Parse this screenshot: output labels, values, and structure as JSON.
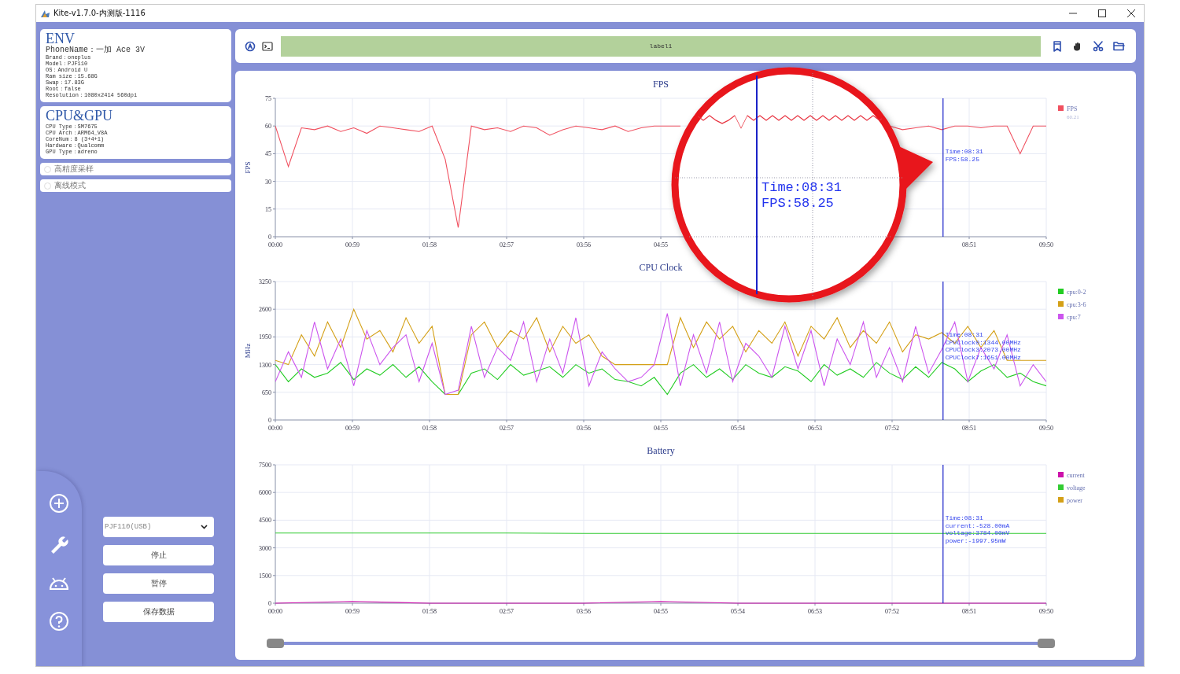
{
  "window": {
    "title": "Kite-v1.7.0-内测版-1116"
  },
  "env_card": {
    "title": "ENV",
    "lines": [
      "PhoneName：一加 Ace 3V",
      "Brand：oneplus",
      "Model：PJF110",
      "OS：Android U",
      "Ram size：15.68G",
      "Swap：17.83G",
      "Root：false",
      "Resolution：1080x2414 560dpi"
    ]
  },
  "cpu_card": {
    "title": "CPU&GPU",
    "lines": [
      "CPU Type：SM7675",
      "CPU Arch：ARM64_V8A",
      "CoreNum：8 (3+4+1)",
      "Hardware：Qualcomm",
      "GPU Type：adreno"
    ]
  },
  "options": [
    {
      "label": "高精度采样",
      "checked": false
    },
    {
      "label": "离线模式",
      "checked": false
    }
  ],
  "device_select": {
    "value": "PJF110(USB)"
  },
  "buttons": [
    "停止",
    "暂停",
    "保存数据"
  ],
  "toolbar": {
    "label": "label1"
  },
  "charts": [
    {
      "legend_note": "60.21",
      "tooltip": [
        "Time:08:31",
        "FPS:58.25"
      ],
      "chart_data": {
        "type": "line",
        "title": "FPS",
        "ylabel": "FPS",
        "grid": true,
        "legend": true,
        "xlim": [
          0,
          590
        ],
        "ylim": [
          0,
          75
        ],
        "yticks": [
          0,
          15,
          30,
          45,
          60,
          75
        ],
        "xticks": [
          {
            "value": 0,
            "label": "00:00"
          },
          {
            "value": 59,
            "label": "00:59"
          },
          {
            "value": 118,
            "label": "01:58"
          },
          {
            "value": 177,
            "label": "02:57"
          },
          {
            "value": 236,
            "label": "03:56"
          },
          {
            "value": 295,
            "label": "04:55"
          },
          {
            "value": 531,
            "label": "08:51"
          },
          {
            "value": 590,
            "label": "09:50"
          }
        ],
        "x": [
          0,
          10,
          20,
          30,
          40,
          50,
          60,
          70,
          80,
          90,
          100,
          110,
          120,
          130,
          140,
          150,
          160,
          170,
          180,
          190,
          200,
          210,
          220,
          230,
          240,
          250,
          260,
          270,
          280,
          290,
          300,
          310,
          470,
          480,
          490,
          500,
          510,
          520,
          530,
          540,
          550,
          560,
          570,
          580,
          590
        ],
        "series": [
          {
            "name": "FPS",
            "color": "#f0505f",
            "values": [
              60,
              38,
              59,
              58,
              60,
              57,
              59,
              56,
              60,
              59,
              58,
              57,
              60,
              42,
              5,
              60,
              58,
              59,
              57,
              60,
              59,
              55,
              58,
              60,
              59,
              58,
              60,
              57,
              59,
              60,
              60,
              60,
              60,
              58,
              59,
              60,
              58,
              60,
              60,
              59,
              60,
              60,
              45,
              60,
              60
            ]
          }
        ],
        "ref_lines": [
          {
            "axis": "x",
            "value": 511,
            "color": "#1a22c8"
          }
        ]
      }
    },
    {
      "tooltip": [
        "Time:08:31",
        "CPUClock0:1344.00MHz",
        "CPUClock3:2073.00MHz",
        "CPUClock7:1651.00MHz"
      ],
      "chart_data": {
        "type": "line",
        "title": "CPU Clock",
        "ylabel": "MHz",
        "grid": true,
        "legend": true,
        "xlim": [
          0,
          590
        ],
        "ylim": [
          0,
          3250
        ],
        "yticks": [
          0,
          650,
          1300,
          1950,
          2600,
          3250
        ],
        "xticks": [
          {
            "value": 0,
            "label": "00:00"
          },
          {
            "value": 59,
            "label": "00:59"
          },
          {
            "value": 118,
            "label": "01:58"
          },
          {
            "value": 177,
            "label": "02:57"
          },
          {
            "value": 236,
            "label": "03:56"
          },
          {
            "value": 295,
            "label": "04:55"
          },
          {
            "value": 354,
            "label": "05:54"
          },
          {
            "value": 413,
            "label": "06:53"
          },
          {
            "value": 472,
            "label": "07:52"
          },
          {
            "value": 531,
            "label": "08:51"
          },
          {
            "value": 590,
            "label": "09:50"
          }
        ],
        "x": [
          0,
          10,
          20,
          30,
          40,
          50,
          60,
          70,
          80,
          90,
          100,
          110,
          120,
          130,
          140,
          150,
          160,
          170,
          180,
          190,
          200,
          210,
          220,
          230,
          240,
          250,
          260,
          270,
          280,
          290,
          300,
          310,
          320,
          330,
          340,
          350,
          360,
          370,
          380,
          390,
          400,
          410,
          420,
          430,
          440,
          450,
          460,
          470,
          480,
          490,
          500,
          510,
          520,
          530,
          540,
          550,
          560,
          570,
          580,
          590
        ],
        "series": [
          {
            "name": "cpu:0-2",
            "color": "#22cc22",
            "values": [
              1300,
              900,
              1200,
              1000,
              1100,
              1350,
              950,
              1200,
              1050,
              1300,
              1000,
              1250,
              900,
              600,
              600,
              1100,
              1200,
              950,
              1300,
              1050,
              1150,
              1250,
              1000,
              1300,
              1100,
              1200,
              950,
              900,
              800,
              1000,
              600,
              1100,
              1300,
              1000,
              1200,
              950,
              1300,
              1100,
              1000,
              1250,
              1150,
              900,
              1300,
              1050,
              1200,
              1000,
              1350,
              1100,
              950,
              1250,
              1000,
              1350,
              1200,
              900,
              1150,
              1300,
              1000,
              1100,
              900,
              800
            ]
          },
          {
            "name": "cpu:3-6",
            "color": "#d4a017",
            "values": [
              1400,
              1300,
              2000,
              1500,
              2300,
              1700,
              2600,
              1900,
              2100,
              1600,
              2400,
              1800,
              2200,
              600,
              600,
              2000,
              2300,
              1700,
              2100,
              1900,
              2400,
              1600,
              2200,
              1800,
              2000,
              1500,
              1300,
              1300,
              1300,
              1300,
              1300,
              2400,
              1700,
              2300,
              1900,
              2200,
              1600,
              2100,
              1800,
              2300,
              1500,
              2200,
              1900,
              2400,
              1700,
              2100,
              1800,
              2300,
              1600,
              2000,
              1900,
              2050,
              1800,
              2200,
              1700,
              2100,
              1400,
              1400,
              1400,
              1400
            ]
          },
          {
            "name": "cpu:7",
            "color": "#cc55ee",
            "values": [
              900,
              1600,
              1000,
              2300,
              1200,
              1900,
              800,
              2100,
              1300,
              1700,
              2000,
              900,
              1800,
              600,
              700,
              2200,
              1000,
              1700,
              1400,
              2300,
              900,
              1900,
              1100,
              2400,
              800,
              1600,
              1200,
              900,
              1000,
              1300,
              2500,
              800,
              2000,
              1100,
              2300,
              900,
              1800,
              1500,
              1000,
              2200,
              1200,
              2100,
              800,
              1900,
              1300,
              2300,
              1000,
              1700,
              900,
              2200,
              1100,
              1650,
              2300,
              900,
              1700,
              1200,
              2000,
              800,
              1300,
              900
            ]
          }
        ],
        "ref_lines": [
          {
            "axis": "x",
            "value": 511,
            "color": "#1a22c8"
          }
        ]
      }
    },
    {
      "tooltip": [
        "Time:08:31",
        "current:-528.00mA",
        "voltage:3784.00mV",
        "power:-1997.95mW"
      ],
      "chart_data": {
        "type": "line",
        "title": "Battery",
        "grid": true,
        "legend": true,
        "xlim": [
          0,
          590
        ],
        "ylim": [
          0,
          7500
        ],
        "yticks": [
          0,
          1500,
          3000,
          4500,
          6000,
          7500
        ],
        "xticks": [
          {
            "value": 0,
            "label": "00:00"
          },
          {
            "value": 59,
            "label": "00:59"
          },
          {
            "value": 118,
            "label": "01:58"
          },
          {
            "value": 177,
            "label": "02:57"
          },
          {
            "value": 236,
            "label": "03:56"
          },
          {
            "value": 295,
            "label": "04:55"
          },
          {
            "value": 354,
            "label": "05:54"
          },
          {
            "value": 413,
            "label": "06:53"
          },
          {
            "value": 472,
            "label": "07:52"
          },
          {
            "value": 531,
            "label": "08:51"
          },
          {
            "value": 590,
            "label": "09:50"
          }
        ],
        "x": [
          0,
          59,
          118,
          177,
          236,
          295,
          354,
          413,
          472,
          531,
          590
        ],
        "series": [
          {
            "name": "current",
            "color": "#cc11aa",
            "values": [
              0,
              100,
              0,
              0,
              0,
              100,
              0,
              0,
              0,
              0,
              0
            ]
          },
          {
            "name": "voltage",
            "color": "#33cc33",
            "values": [
              3800,
              3800,
              3800,
              3800,
              3780,
              3780,
              3780,
              3780,
              3780,
              3780,
              3780
            ]
          },
          {
            "name": "power",
            "color": "#d4a017",
            "values": [
              null,
              null,
              null,
              null,
              null,
              null,
              null,
              null,
              null,
              null,
              null
            ]
          }
        ],
        "ref_lines": [
          {
            "axis": "x",
            "value": 511,
            "color": "#1a22c8"
          }
        ]
      }
    }
  ],
  "slider": {
    "handles": [
      {
        "level": 0
      },
      {
        "level": 1
      }
    ]
  },
  "magnifier": {
    "lines": [
      "Time:08:31",
      "FPS:58.25"
    ]
  }
}
